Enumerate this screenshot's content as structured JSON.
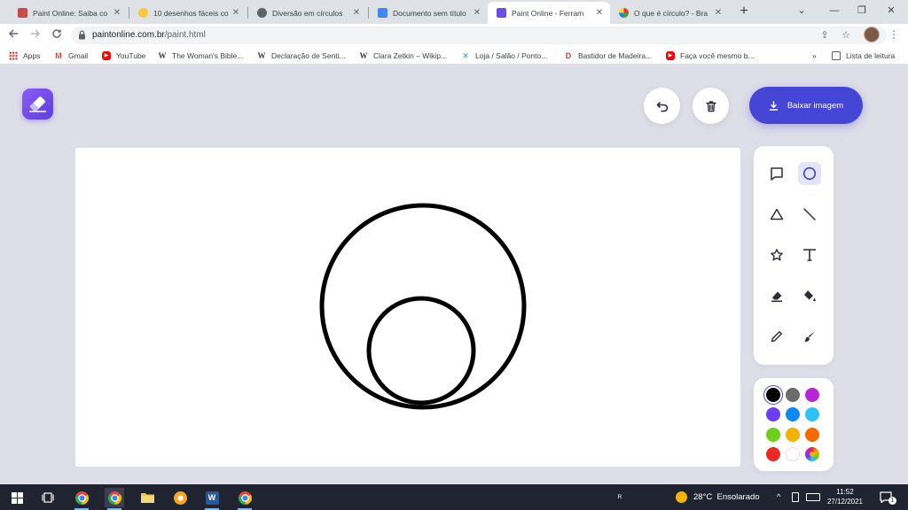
{
  "browser": {
    "tabs": [
      {
        "title": "Paint Online: Saiba co",
        "icon": "paint-online-favicon"
      },
      {
        "title": "10 desenhos fáceis co",
        "icon": "sun-favicon"
      },
      {
        "title": "Diversão em círculos",
        "icon": "globe-favicon"
      },
      {
        "title": "Documento sem título",
        "icon": "google-docs-favicon"
      },
      {
        "title": "Paint Online - Ferram",
        "icon": "paint-online-favicon",
        "active": true
      },
      {
        "title": "O que é círculo? - Bra",
        "icon": "brasil-escola-favicon"
      }
    ],
    "address": {
      "domain": "paintonline.com.br",
      "path": "/paint.html"
    },
    "bookmarks": [
      {
        "label": "Apps",
        "icon": "apps-grid-icon"
      },
      {
        "label": "Gmail",
        "icon": "gmail-icon"
      },
      {
        "label": "YouTube",
        "icon": "youtube-icon"
      },
      {
        "label": "The Woman's Bible...",
        "icon": "wikipedia-icon"
      },
      {
        "label": "Declaração de Senti...",
        "icon": "wikipedia-icon"
      },
      {
        "label": "Clara Zetkin – Wikip...",
        "icon": "wikipedia-icon"
      },
      {
        "label": "Loja / Salão / Ponto...",
        "icon": "bird-icon"
      },
      {
        "label": "Bastidor de Madeira...",
        "icon": "store-icon"
      },
      {
        "label": "Faça você mesmo b...",
        "icon": "youtube-icon"
      }
    ],
    "reading_list": "Lista de leitura"
  },
  "app": {
    "download_label": "Baixar imagem",
    "tools": [
      "square",
      "circle",
      "triangle",
      "line",
      "star",
      "text",
      "eraser",
      "fill",
      "pencil",
      "brush"
    ],
    "selected_tool": "circle",
    "palette": [
      "#000000",
      "#6b6b6b",
      "#b428d8",
      "#6a3cf2",
      "#0d8bf2",
      "#2cc2f5",
      "#6ccf1a",
      "#f5b000",
      "#f56a00",
      "#ec2a25",
      "#ffffff",
      "rainbow"
    ],
    "selected_color": "#000000"
  },
  "taskbar": {
    "weather": "28°C  Ensolarado",
    "time": "11:52",
    "date": "27/12/2021",
    "notification_count": "1"
  }
}
